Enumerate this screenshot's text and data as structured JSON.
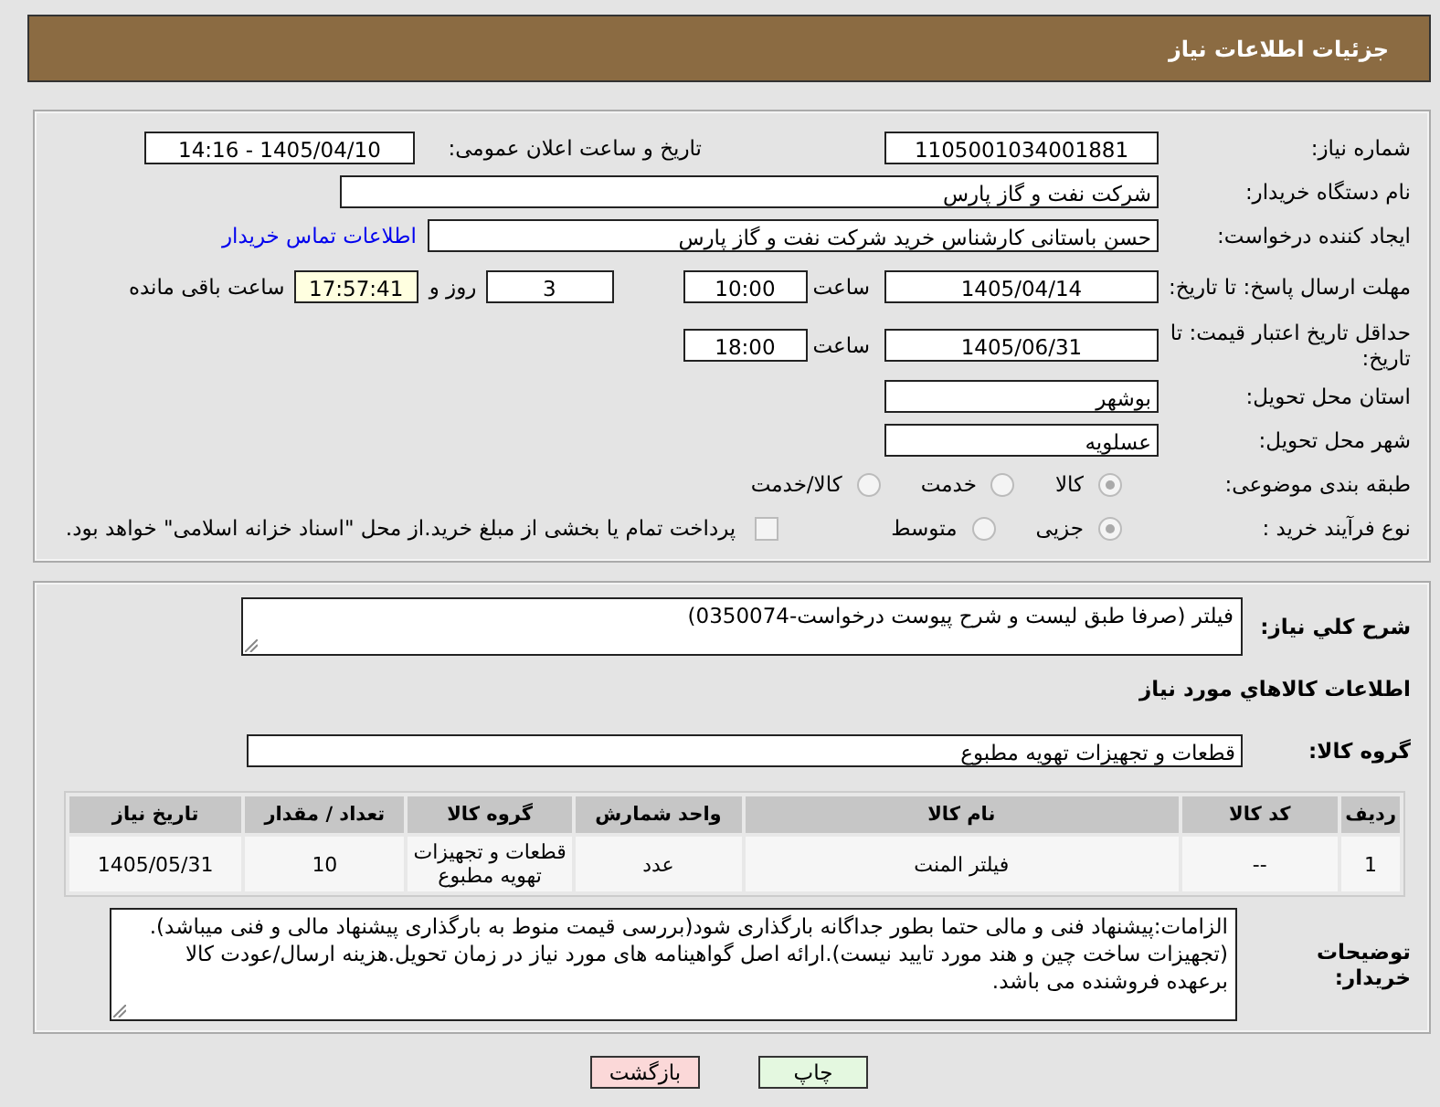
{
  "header": {
    "title": "جزئیات اطلاعات نیاز"
  },
  "details": {
    "need_number": {
      "label": "شماره نیاز:",
      "value": "1105001034001881"
    },
    "announce": {
      "label": "تاریخ و ساعت اعلان عمومی:",
      "value": "1405/04/10 - 14:16"
    },
    "buyer": {
      "label": "نام دستگاه خریدار:",
      "value": "شرکت نفت و گاز پارس"
    },
    "creator": {
      "label": "ایجاد کننده درخواست:",
      "value": "حسن باستانی کارشناس خرید شرکت نفت و گاز پارس",
      "link": "اطلاعات تماس خریدار"
    },
    "deadline": {
      "label": "مهلت ارسال پاسخ: تا تاریخ:",
      "date": "1405/04/14",
      "time_label": "ساعت",
      "time": "10:00",
      "days": "3",
      "days_label": "روز و",
      "remaining": "17:57:41",
      "remaining_label": "ساعت باقی مانده"
    },
    "validity": {
      "label": "حداقل تاریخ اعتبار قیمت: تا تاریخ:",
      "date": "1405/06/31",
      "time_label": "ساعت",
      "time": "18:00"
    },
    "province": {
      "label": "استان محل تحویل:",
      "value": "بوشهر"
    },
    "city": {
      "label": "شهر محل تحویل:",
      "value": "عسلویه"
    },
    "category": {
      "label": "طبقه بندی موضوعی:",
      "options": [
        {
          "label": "کالا",
          "selected": true
        },
        {
          "label": "خدمت",
          "selected": false
        },
        {
          "label": "کالا/خدمت",
          "selected": false
        }
      ]
    },
    "process": {
      "label": "نوع فرآیند خرید :",
      "options": [
        {
          "label": "جزیی",
          "selected": true
        },
        {
          "label": "متوسط",
          "selected": false
        }
      ],
      "payment": {
        "label": "پرداخت تمام یا بخشی از مبلغ خرید.از محل \"اسناد خزانه اسلامی\" خواهد بود.",
        "checked": false
      }
    }
  },
  "need": {
    "description_label": "شرح کلي نياز:",
    "description": "فیلتر (صرفا طبق لیست و شرح پیوست درخواست-0350074)",
    "items_heading": "اطلاعات کالاهاي مورد نياز",
    "group_label": "گروه کالا:",
    "group": "قطعات و تجهیزات تهویه مطبوع"
  },
  "table": {
    "columns": [
      "ردیف",
      "کد کالا",
      "نام کالا",
      "واحد شمارش",
      "گروه کالا",
      "تعداد / مقدار",
      "تاریخ نیاز"
    ],
    "rows": [
      [
        "1",
        "--",
        "فیلتر المنت",
        "عدد",
        "قطعات و تجهیزات تهویه مطبوع",
        "10",
        "1405/05/31"
      ]
    ]
  },
  "notes": {
    "label": "توضیحات خریدار:",
    "text": "الزامات:پیشنهاد فنی و مالی حتما  بطور جداگانه بارگذاری شود(بررسی قیمت منوط به بارگذاری پیشنهاد مالی و فنی میباشد).(تجهیزات ساخت چین و هند مورد تایید نیست).ارائه اصل گواهینامه های مورد نیاز در زمان تحویل.هزینه ارسال/عودت کالا برعهده فروشنده می باشد."
  },
  "buttons": [
    {
      "label": "چاپ",
      "kind": "print"
    },
    {
      "label": "بازگشت",
      "kind": "back"
    }
  ]
}
